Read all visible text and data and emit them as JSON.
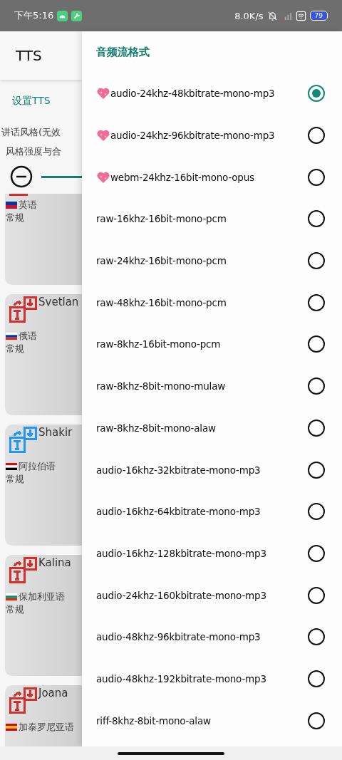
{
  "status_bar": {
    "time": "下午5:16",
    "speed": "8.0K/s",
    "battery": "79"
  },
  "app": {
    "title": "TTS",
    "tab": "设置TTS",
    "style_line": "讲话风格(无效",
    "strength_line": "风格强度与合",
    "voices": [
      {
        "kind": "partial",
        "color": "#d32f2f",
        "language": "英语",
        "style": "常规"
      },
      {
        "kind": "full",
        "color": "#d32f2f",
        "name": "Svetlan",
        "language": "俄语",
        "style": "常规"
      },
      {
        "kind": "full",
        "color": "#2196f3",
        "name": "Shakir",
        "language": "阿拉伯语",
        "style": "常规"
      },
      {
        "kind": "full",
        "color": "#d32f2f",
        "name": "Kalina",
        "language": "保加利亚语",
        "style": "常规"
      },
      {
        "kind": "full",
        "color": "#d32f2f",
        "name": "Joana",
        "language": "加泰罗尼亚语"
      }
    ]
  },
  "drawer": {
    "title": "音频流格式",
    "options": [
      {
        "label": "audio-24khz-48kbitrate-mono-mp3",
        "featured": true,
        "selected": true
      },
      {
        "label": "audio-24khz-96kbitrate-mono-mp3",
        "featured": true,
        "selected": false
      },
      {
        "label": "webm-24khz-16bit-mono-opus",
        "featured": true,
        "selected": false
      },
      {
        "label": "raw-16khz-16bit-mono-pcm",
        "featured": false,
        "selected": false
      },
      {
        "label": "raw-24khz-16bit-mono-pcm",
        "featured": false,
        "selected": false
      },
      {
        "label": "raw-48khz-16bit-mono-pcm",
        "featured": false,
        "selected": false
      },
      {
        "label": "raw-8khz-16bit-mono-pcm",
        "featured": false,
        "selected": false
      },
      {
        "label": "raw-8khz-8bit-mono-mulaw",
        "featured": false,
        "selected": false
      },
      {
        "label": "raw-8khz-8bit-mono-alaw",
        "featured": false,
        "selected": false
      },
      {
        "label": "audio-16khz-32kbitrate-mono-mp3",
        "featured": false,
        "selected": false
      },
      {
        "label": "audio-16khz-64kbitrate-mono-mp3",
        "featured": false,
        "selected": false
      },
      {
        "label": "audio-16khz-128kbitrate-mono-mp3",
        "featured": false,
        "selected": false
      },
      {
        "label": "audio-24khz-160kbitrate-mono-mp3",
        "featured": false,
        "selected": false
      },
      {
        "label": "audio-48khz-96kbitrate-mono-mp3",
        "featured": false,
        "selected": false
      },
      {
        "label": "audio-48khz-192kbitrate-mono-mp3",
        "featured": false,
        "selected": false
      },
      {
        "label": "riff-8khz-8bit-mono-alaw",
        "featured": false,
        "selected": false
      }
    ]
  }
}
